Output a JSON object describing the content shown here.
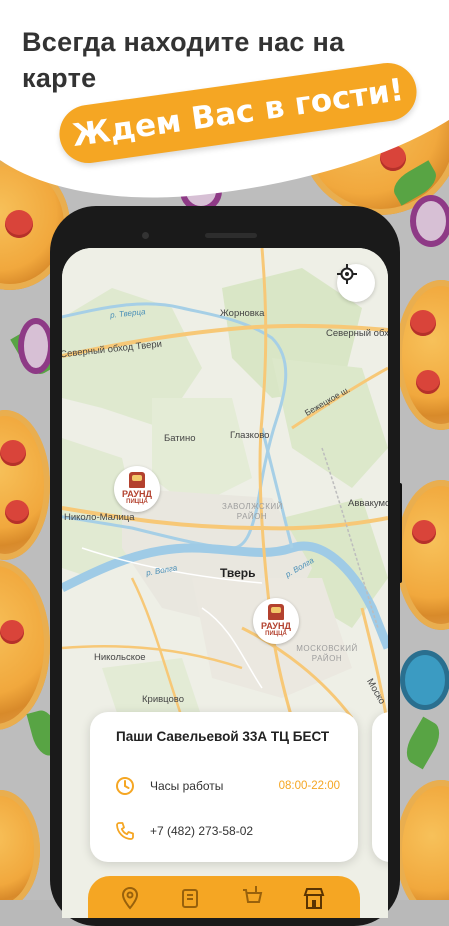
{
  "promo": {
    "headline": "Всегда находите нас на карте",
    "ribbon": "Ждем Вас в гости!"
  },
  "map": {
    "labels": {
      "zhornovka": "Жорновка",
      "river_tvertsa": "р. Тверца",
      "north_bypass_left": "Северный обход Твери",
      "north_bypass_right": "Северный обх",
      "bezhetskoe": "Бежецкое ш.",
      "batino": "Батино",
      "glazkovo": "Глазково",
      "zavolzhsky": "ЗАВОЛЖСКИЙ РАЙОН",
      "avvakumovo": "Аввакумо",
      "nikolo_malitsa": "Николо-Малица",
      "river_volga_left": "р. Волга",
      "river_volga_right": "р. Волга",
      "tver": "Тверь",
      "moskovsky": "МОСКОВСКИЙ РАЙОН",
      "nikolskoe": "Никольское",
      "krivtsovo": "Кривцово",
      "mosk": "Моско"
    },
    "markers": [
      {
        "name": "РАУНД",
        "sub": "ПИЦЦА"
      },
      {
        "name": "РАУНД",
        "sub": "ПИЦЦА"
      }
    ]
  },
  "card": {
    "address": "Паши Савельевой 33А ТЦ БЕСТ",
    "hours_label": "Часы работы",
    "hours_value": "08:00-22:00",
    "phone": "+7 (482) 273-58-02"
  },
  "colors": {
    "accent": "#f5a623",
    "brand": "#b3412e"
  },
  "icons": {
    "locate": "locate-icon",
    "clock": "clock-icon",
    "phone": "phone-icon"
  }
}
